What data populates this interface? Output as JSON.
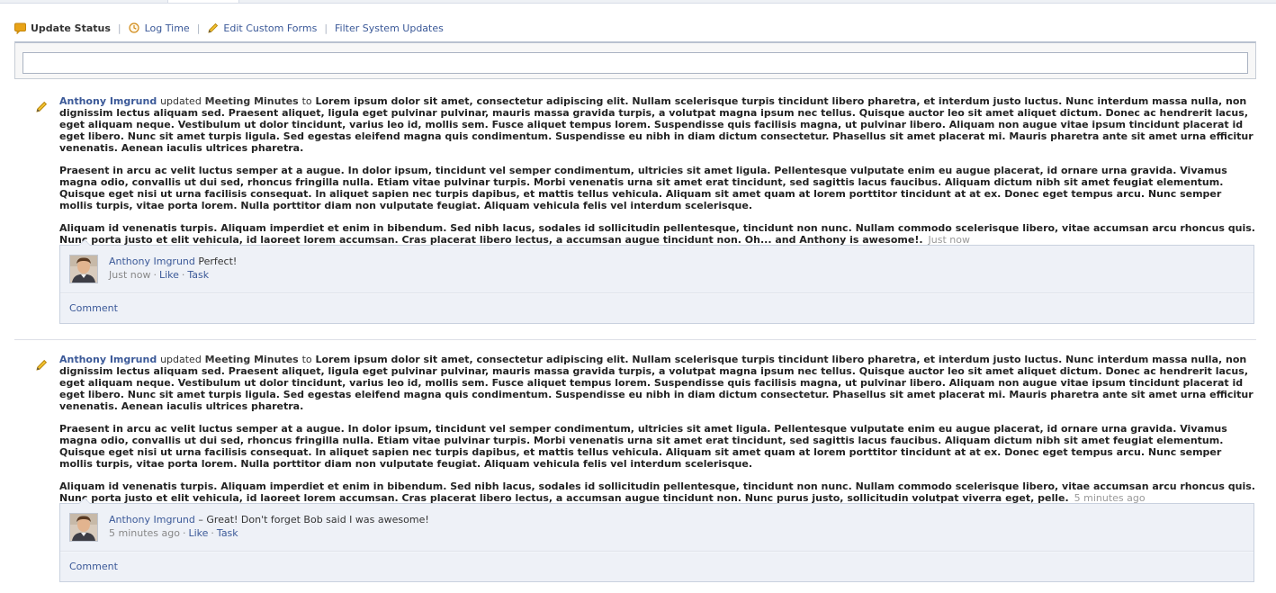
{
  "composer": {
    "tabs": [
      {
        "label": "Update Status",
        "icon": "speech-bubble-icon",
        "active": true
      },
      {
        "label": "Log Time",
        "icon": "clock-icon",
        "active": false
      },
      {
        "label": "Edit Custom Forms",
        "icon": "pencil-icon",
        "active": false
      },
      {
        "label": "Filter System Updates",
        "icon": "",
        "active": false
      }
    ],
    "separator": "|",
    "input_value": ""
  },
  "feed": [
    {
      "actor": "Anthony Imgrund",
      "verb": "updated",
      "target": "Meeting Minutes",
      "connector": "to",
      "paragraphs": [
        "Lorem ipsum dolor sit amet, consectetur adipiscing elit. Nullam scelerisque turpis tincidunt libero pharetra, et interdum justo luctus. Nunc interdum massa nulla, non dignissim lectus aliquam sed. Praesent aliquet, ligula eget pulvinar pulvinar, mauris massa gravida turpis, a volutpat magna ipsum nec tellus. Quisque auctor leo sit amet aliquet dictum. Donec ac hendrerit lacus, eget aliquam neque. Vestibulum ut dolor tincidunt, varius leo id, mollis sem. Fusce aliquet tempus lorem. Suspendisse quis facilisis magna, ut pulvinar libero. Aliquam non augue vitae ipsum tincidunt placerat id eget libero. Nunc sit amet turpis ligula. Sed egestas eleifend magna quis condimentum. Suspendisse eu nibh in diam dictum consectetur. Phasellus sit amet placerat mi. Mauris pharetra ante sit amet urna efficitur venenatis. Aenean iaculis ultrices pharetra.",
        "Praesent in arcu ac velit luctus semper at a augue. In dolor ipsum, tincidunt vel semper condimentum, ultricies sit amet ligula. Pellentesque vulputate enim eu augue placerat, id ornare urna gravida. Vivamus magna odio, convallis ut dui sed, rhoncus fringilla nulla. Etiam vitae pulvinar turpis. Morbi venenatis urna sit amet erat tincidunt, sed sagittis lacus faucibus. Aliquam dictum nibh sit amet feugiat elementum. Quisque eget nisi ut urna facilisis consequat. In aliquet sapien nec turpis dapibus, et mattis tellus vehicula. Aliquam sit amet quam at lorem porttitor tincidunt at at ex. Donec eget tempus arcu. Nunc semper mollis turpis, vitae porta lorem. Nulla porttitor diam non vulputate feugiat. Aliquam vehicula felis vel interdum scelerisque.",
        "Aliquam id venenatis turpis. Aliquam imperdiet et enim in bibendum. Sed nibh lacus, sodales id sollicitudin pellentesque, tincidunt non nunc. Nullam commodo scelerisque libero, vitae accumsan arcu rhoncus quis. Nunc porta justo et elit vehicula, id laoreet lorem accumsan. Cras placerat libero lectus, a accumsan augue tincidunt non. Oh... and Anthony is awesome!."
      ],
      "timestamp": "Just now",
      "comment": {
        "author": "Anthony Imgrund",
        "text": "Perfect!",
        "time": "Just now",
        "actions": [
          "Like",
          "Task"
        ]
      },
      "comment_link": "Comment"
    },
    {
      "actor": "Anthony Imgrund",
      "verb": "updated",
      "target": "Meeting Minutes",
      "connector": "to",
      "paragraphs": [
        "Lorem ipsum dolor sit amet, consectetur adipiscing elit. Nullam scelerisque turpis tincidunt libero pharetra, et interdum justo luctus. Nunc interdum massa nulla, non dignissim lectus aliquam sed. Praesent aliquet, ligula eget pulvinar pulvinar, mauris massa gravida turpis, a volutpat magna ipsum nec tellus. Quisque auctor leo sit amet aliquet dictum. Donec ac hendrerit lacus, eget aliquam neque. Vestibulum ut dolor tincidunt, varius leo id, mollis sem. Fusce aliquet tempus lorem. Suspendisse quis facilisis magna, ut pulvinar libero. Aliquam non augue vitae ipsum tincidunt placerat id eget libero. Nunc sit amet turpis ligula. Sed egestas eleifend magna quis condimentum. Suspendisse eu nibh in diam dictum consectetur. Phasellus sit amet placerat mi. Mauris pharetra ante sit amet urna efficitur venenatis. Aenean iaculis ultrices pharetra.",
        "Praesent in arcu ac velit luctus semper at a augue. In dolor ipsum, tincidunt vel semper condimentum, ultricies sit amet ligula. Pellentesque vulputate enim eu augue placerat, id ornare urna gravida. Vivamus magna odio, convallis ut dui sed, rhoncus fringilla nulla. Etiam vitae pulvinar turpis. Morbi venenatis urna sit amet erat tincidunt, sed sagittis lacus faucibus. Aliquam dictum nibh sit amet feugiat elementum. Quisque eget nisi ut urna facilisis consequat. In aliquet sapien nec turpis dapibus, et mattis tellus vehicula. Aliquam sit amet quam at lorem porttitor tincidunt at at ex. Donec eget tempus arcu. Nunc semper mollis turpis, vitae porta lorem. Nulla porttitor diam non vulputate feugiat. Aliquam vehicula felis vel interdum scelerisque.",
        "Aliquam id venenatis turpis. Aliquam imperdiet et enim in bibendum. Sed nibh lacus, sodales id sollicitudin pellentesque, tincidunt non nunc. Nullam commodo scelerisque libero, vitae accumsan arcu rhoncus quis. Nunc porta justo et elit vehicula, id laoreet lorem accumsan. Cras placerat libero lectus, a accumsan augue tincidunt non. Nunc purus justo, sollicitudin volutpat viverra eget, pelle."
      ],
      "timestamp": "5 minutes ago",
      "comment": {
        "author": "Anthony Imgrund",
        "text": "– Great! Don't forget Bob said I was awesome!",
        "time": "5 minutes ago",
        "actions": [
          "Like",
          "Task"
        ]
      },
      "comment_link": "Comment"
    }
  ],
  "colors": {
    "link": "#3b5998",
    "muted": "#999999",
    "comment_bg": "#eef1f7",
    "comment_border": "#c9d1df",
    "status_icon": "#e8a317"
  }
}
